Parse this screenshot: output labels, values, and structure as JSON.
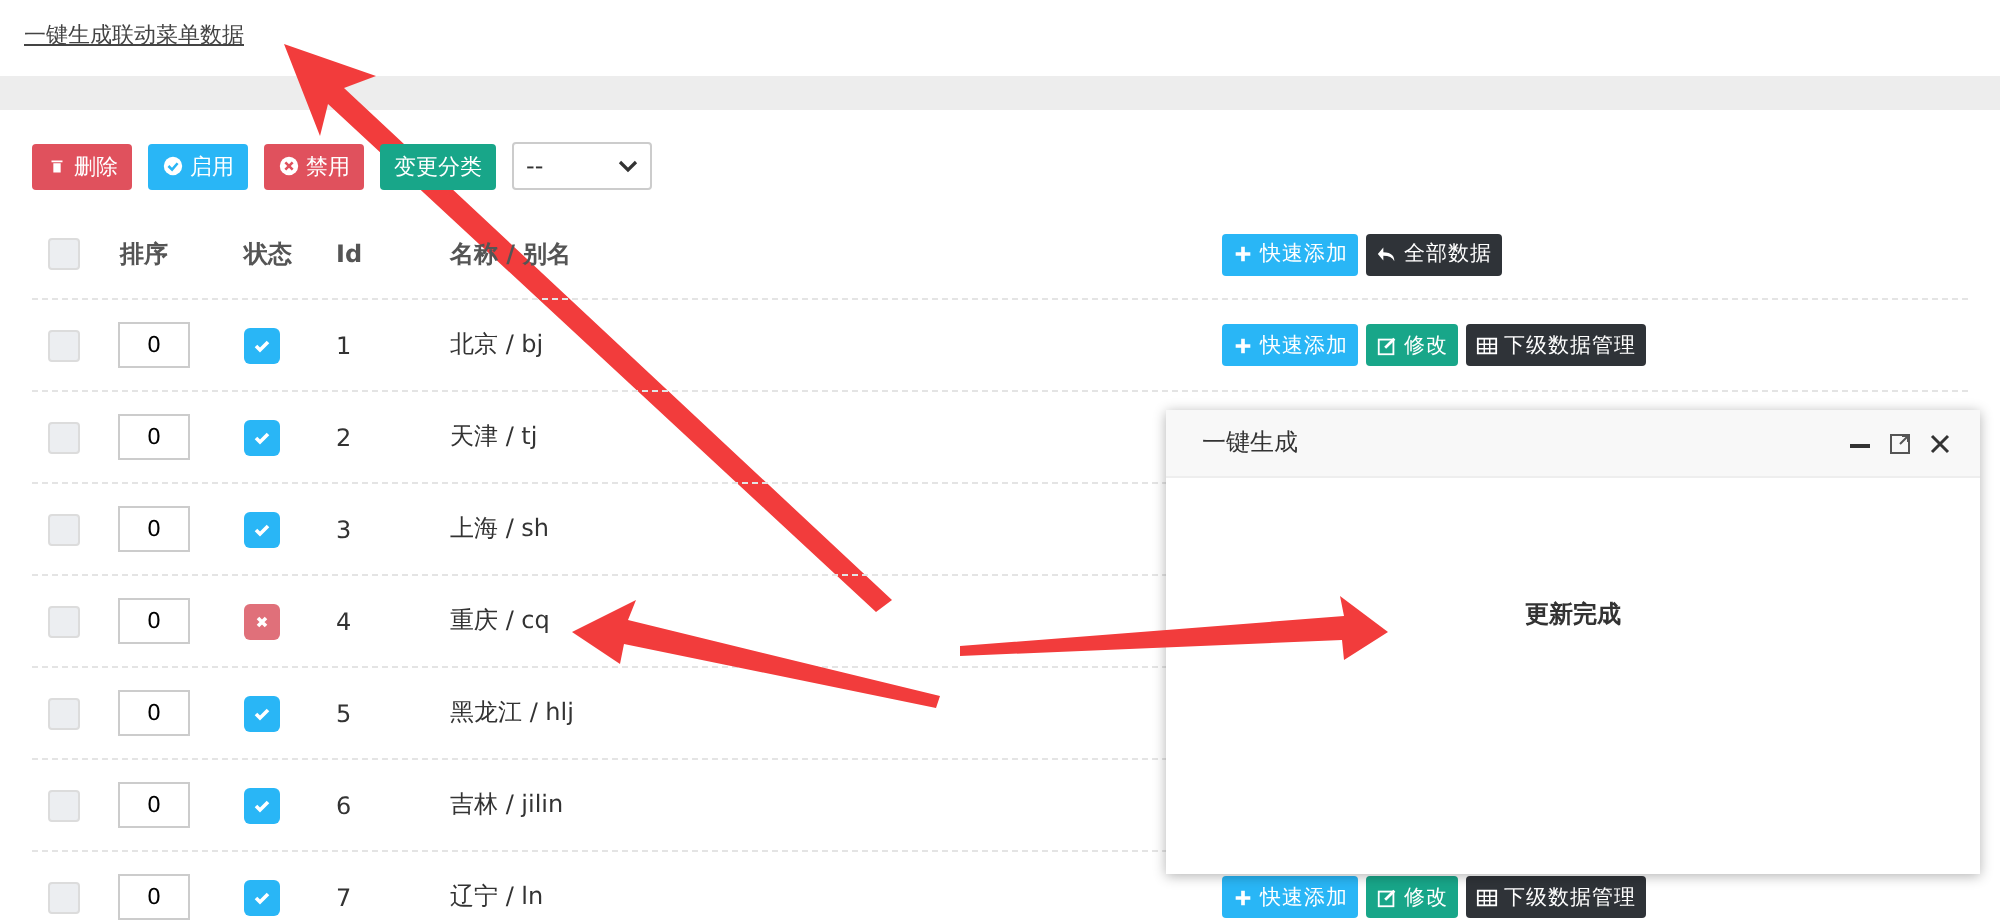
{
  "top_link": "一键生成联动菜单数据",
  "toolbar": [
    {
      "label": "删除",
      "kind": "delete"
    },
    {
      "label": "启用",
      "kind": "enable"
    },
    {
      "label": "禁用",
      "kind": "disable"
    },
    {
      "label": "变更分类",
      "kind": "category"
    }
  ],
  "category_select": {
    "value": "--"
  },
  "table": {
    "header_checked": false,
    "columns": [
      "排序",
      "状态",
      "Id",
      "名称 / 别名"
    ],
    "header_actions": [
      {
        "label": "快速添加",
        "kind": "add"
      },
      {
        "label": "全部数据",
        "kind": "all"
      }
    ],
    "rows": [
      {
        "checked": false,
        "sort": "0",
        "enabled": true,
        "id": "1",
        "name": "北京 / bj",
        "actions": [
          {
            "label": "快速添加",
            "kind": "add"
          },
          {
            "label": "修改",
            "kind": "edit"
          },
          {
            "label": "下级数据管理",
            "kind": "sub"
          }
        ]
      },
      {
        "checked": false,
        "sort": "0",
        "enabled": true,
        "id": "2",
        "name": "天津 / tj"
      },
      {
        "checked": false,
        "sort": "0",
        "enabled": true,
        "id": "3",
        "name": "上海 / sh"
      },
      {
        "checked": false,
        "sort": "0",
        "enabled": false,
        "id": "4",
        "name": "重庆 / cq"
      },
      {
        "checked": false,
        "sort": "0",
        "enabled": true,
        "id": "5",
        "name": "黑龙江 / hlj"
      },
      {
        "checked": false,
        "sort": "0",
        "enabled": true,
        "id": "6",
        "name": "吉林 / jilin"
      },
      {
        "checked": false,
        "sort": "0",
        "enabled": true,
        "id": "7",
        "name": "辽宁 / ln",
        "actions": [
          {
            "label": "快速添加",
            "kind": "add"
          },
          {
            "label": "修改",
            "kind": "edit"
          },
          {
            "label": "下级数据管理",
            "kind": "sub"
          }
        ]
      }
    ]
  },
  "dialog": {
    "title": "一键生成",
    "message": "更新完成"
  }
}
